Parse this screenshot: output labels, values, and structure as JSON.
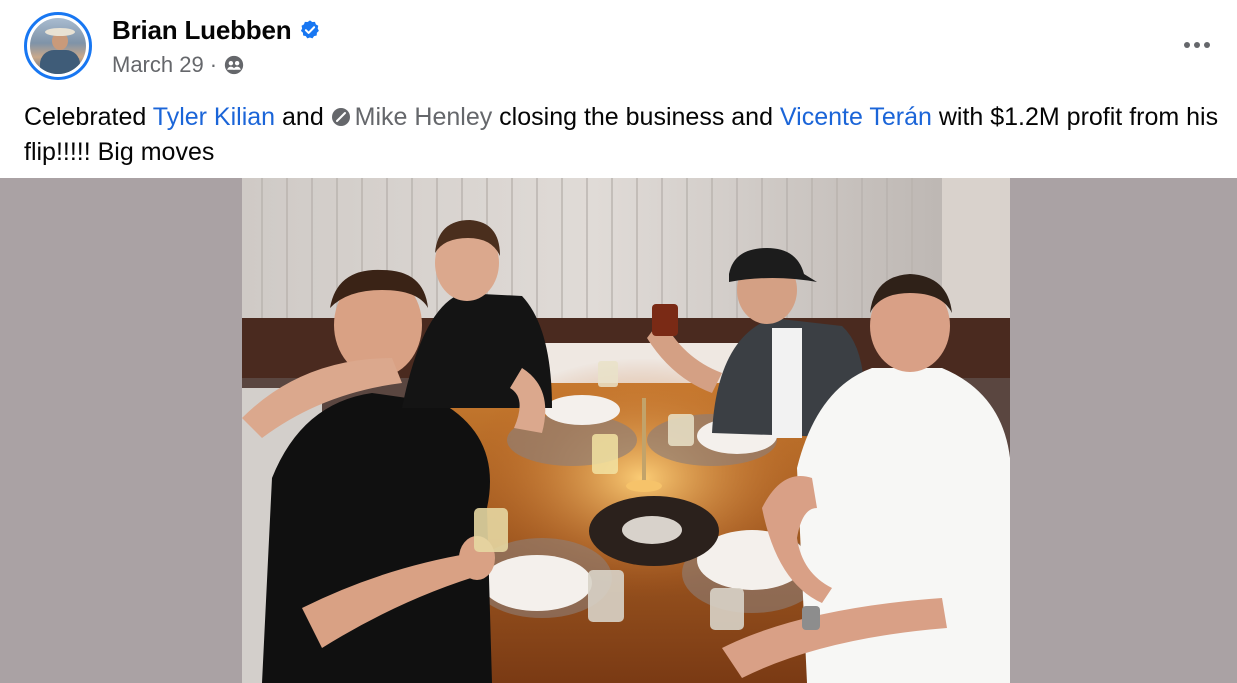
{
  "post": {
    "author": "Brian Luebben",
    "date": "March 29",
    "separator": "·",
    "audience_icon": "friends-icon",
    "verified_icon": "verified-badge-icon",
    "more_icon": "more-options-icon",
    "caption": {
      "t1": "Celebrated ",
      "tag1": "Tyler Kilian",
      "t2": " and ",
      "tag2": "Mike Henley",
      "t3": " closing the business and ",
      "tag3": "Vicente Terán",
      "t4": " with $1.2M profit from his flip!!!!! Big moves"
    }
  },
  "colors": {
    "link_blue": "#1b65d8",
    "verified_blue": "#1877f2",
    "secondary_text": "#65676b",
    "media_background": "#aaa2a4"
  }
}
